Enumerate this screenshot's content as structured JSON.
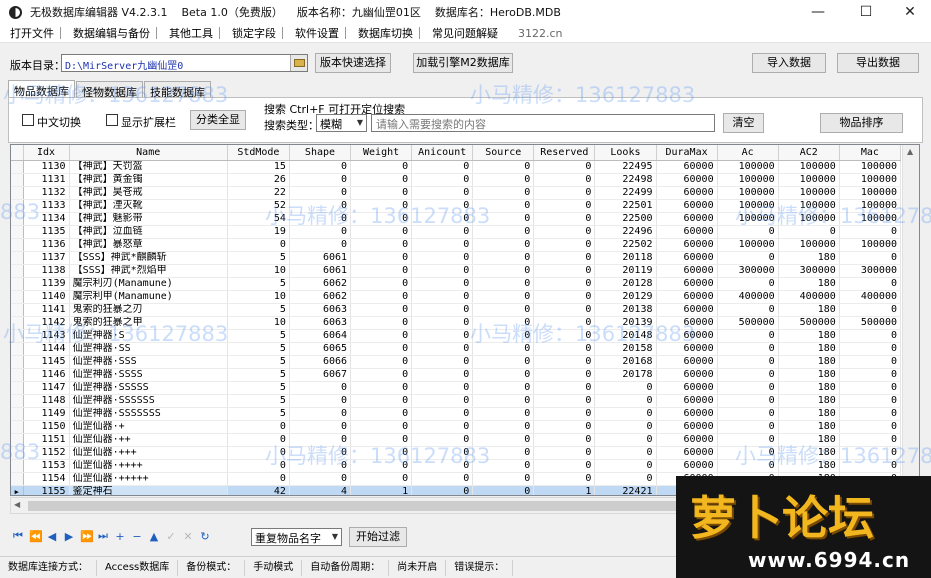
{
  "window": {
    "title": "无极数据库编辑器 V4.2.3.1    Beta 1.0（免费版）    版本名称：九幽仙罡01区    数据库名：HeroDB.MDB",
    "minimize": "—",
    "maximize": "☐",
    "close": "✕"
  },
  "menu": {
    "items": [
      "打开文件",
      "数据编辑与备份",
      "其他工具",
      "锁定字段",
      "软件设置",
      "数据库切换",
      "常见问题解疑"
    ],
    "extra": "3122.cn"
  },
  "toolbar": {
    "dir_label": "版本目录：",
    "dir_value": "D:\\MirServer九幽仙罡0",
    "quick_select": "版本快速选择",
    "load_engine": "加载引擎M2数据库",
    "import": "导入数据",
    "export": "导出数据"
  },
  "tabs": [
    "物品数据库",
    "怪物数据库",
    "技能数据库"
  ],
  "search_panel": {
    "chinese_toggle": "中文切换",
    "show_extra": "显示扩展栏",
    "category_all": "分类全显",
    "search_title": "搜索   Ctrl+F 可打开定位搜索",
    "type_label": "搜索类型：",
    "type_value": "模糊",
    "search_placeholder": "请输入需要搜索的内容",
    "clear": "清空",
    "sort": "物品排序"
  },
  "grid": {
    "columns": [
      "Idx",
      "Name",
      "StdMode",
      "Shape",
      "Weight",
      "Anicount",
      "Source",
      "Reserved",
      "Looks",
      "DuraMax",
      "Ac",
      "AC2",
      "Mac"
    ],
    "rows": [
      [
        "1130",
        "【神武】天罚盔",
        "15",
        "0",
        "0",
        "0",
        "0",
        "0",
        "22495",
        "60000",
        "100000",
        "100000",
        "100000"
      ],
      [
        "1131",
        "【神武】黄金镯",
        "26",
        "0",
        "0",
        "0",
        "0",
        "0",
        "22498",
        "60000",
        "100000",
        "100000",
        "100000"
      ],
      [
        "1132",
        "【神武】昊苍戒",
        "22",
        "0",
        "0",
        "0",
        "0",
        "0",
        "22499",
        "60000",
        "100000",
        "100000",
        "100000"
      ],
      [
        "1133",
        "【神武】湮灭靴",
        "52",
        "0",
        "0",
        "0",
        "0",
        "0",
        "22501",
        "60000",
        "100000",
        "100000",
        "100000"
      ],
      [
        "1134",
        "【神武】魅影带",
        "54",
        "0",
        "0",
        "0",
        "0",
        "0",
        "22500",
        "60000",
        "100000",
        "100000",
        "100000"
      ],
      [
        "1135",
        "【神武】泣血链",
        "19",
        "0",
        "0",
        "0",
        "0",
        "0",
        "22496",
        "60000",
        "0",
        "0",
        "0"
      ],
      [
        "1136",
        "【神武】暴怒章",
        "0",
        "0",
        "0",
        "0",
        "0",
        "0",
        "22502",
        "60000",
        "100000",
        "100000",
        "100000"
      ],
      [
        "1137",
        "【SSS】神武*麒麟斩",
        "5",
        "6061",
        "0",
        "0",
        "0",
        "0",
        "20118",
        "60000",
        "0",
        "180",
        "0"
      ],
      [
        "1138",
        "【SSS】神武*烈焰甲",
        "10",
        "6061",
        "0",
        "0",
        "0",
        "0",
        "20119",
        "60000",
        "300000",
        "300000",
        "300000"
      ],
      [
        "1139",
        "魔宗利刃(Manamune)",
        "5",
        "6062",
        "0",
        "0",
        "0",
        "0",
        "20128",
        "60000",
        "0",
        "180",
        "0"
      ],
      [
        "1140",
        "魔宗利甲(Manamune)",
        "10",
        "6062",
        "0",
        "0",
        "0",
        "0",
        "20129",
        "60000",
        "400000",
        "400000",
        "400000"
      ],
      [
        "1141",
        "鬼索的狂暴之刃",
        "5",
        "6063",
        "0",
        "0",
        "0",
        "0",
        "20138",
        "60000",
        "0",
        "180",
        "0"
      ],
      [
        "1142",
        "鬼索的狂暴之甲",
        "10",
        "6063",
        "0",
        "0",
        "0",
        "0",
        "20139",
        "60000",
        "500000",
        "500000",
        "500000"
      ],
      [
        "1143",
        "仙罡神器·S",
        "5",
        "6064",
        "0",
        "0",
        "0",
        "0",
        "20148",
        "60000",
        "0",
        "180",
        "0"
      ],
      [
        "1144",
        "仙罡神器·SS",
        "5",
        "6065",
        "0",
        "0",
        "0",
        "0",
        "20158",
        "60000",
        "0",
        "180",
        "0"
      ],
      [
        "1145",
        "仙罡神器·SSS",
        "5",
        "6066",
        "0",
        "0",
        "0",
        "0",
        "20168",
        "60000",
        "0",
        "180",
        "0"
      ],
      [
        "1146",
        "仙罡神器·SSSS",
        "5",
        "6067",
        "0",
        "0",
        "0",
        "0",
        "20178",
        "60000",
        "0",
        "180",
        "0"
      ],
      [
        "1147",
        "仙罡神器·SSSSS",
        "5",
        "0",
        "0",
        "0",
        "0",
        "0",
        "0",
        "60000",
        "0",
        "180",
        "0"
      ],
      [
        "1148",
        "仙罡神器·SSSSSS",
        "5",
        "0",
        "0",
        "0",
        "0",
        "0",
        "0",
        "60000",
        "0",
        "180",
        "0"
      ],
      [
        "1149",
        "仙罡神器·SSSSSSS",
        "5",
        "0",
        "0",
        "0",
        "0",
        "0",
        "0",
        "60000",
        "0",
        "180",
        "0"
      ],
      [
        "1150",
        "仙罡仙器·+",
        "0",
        "0",
        "0",
        "0",
        "0",
        "0",
        "0",
        "60000",
        "0",
        "180",
        "0"
      ],
      [
        "1151",
        "仙罡仙器·++",
        "0",
        "0",
        "0",
        "0",
        "0",
        "0",
        "0",
        "60000",
        "0",
        "180",
        "0"
      ],
      [
        "1152",
        "仙罡仙器·+++",
        "0",
        "0",
        "0",
        "0",
        "0",
        "0",
        "0",
        "60000",
        "0",
        "180",
        "0"
      ],
      [
        "1153",
        "仙罡仙器·++++",
        "0",
        "0",
        "0",
        "0",
        "0",
        "0",
        "0",
        "60000",
        "0",
        "180",
        "0"
      ],
      [
        "1154",
        "仙罡仙器·+++++",
        "0",
        "0",
        "0",
        "0",
        "0",
        "0",
        "0",
        "60000",
        "0",
        "180",
        "0"
      ],
      [
        "1155",
        "鉴定神石",
        "42",
        "4",
        "1",
        "0",
        "0",
        "1",
        "22421",
        "",
        "",
        "",
        ""
      ]
    ],
    "selected_row_index": 25,
    "row_pointer": "▶"
  },
  "navigator": {
    "icons": [
      "first-icon",
      "prior-page-icon",
      "prior-icon",
      "next-icon",
      "next-page-icon",
      "last-icon",
      "insert-icon",
      "delete-icon",
      "edit-icon",
      "post-icon",
      "cancel-icon",
      "refresh-icon"
    ],
    "glyphs": [
      "⏮",
      "⏪",
      "◀",
      "▶",
      "⏩",
      "⏭",
      "+",
      "−",
      "▲",
      "✓",
      "✕",
      "↻"
    ],
    "enabled": [
      true,
      true,
      true,
      true,
      true,
      true,
      true,
      true,
      true,
      false,
      false,
      true
    ],
    "color": "#1f5fbf"
  },
  "filter": {
    "select_value": "重复物品名字",
    "start_button": "开始过滤"
  },
  "status": {
    "items": [
      "数据库连接方式：",
      "Access数据库",
      "备份模式：",
      "手动模式",
      "自动备份周期：",
      "尚未开启",
      "错误提示："
    ]
  },
  "watermarks": {
    "text_a": "小马精修：136127883",
    "text_b": "883"
  },
  "logo": {
    "text": "萝卜论坛",
    "url": "www.6994.cn"
  }
}
